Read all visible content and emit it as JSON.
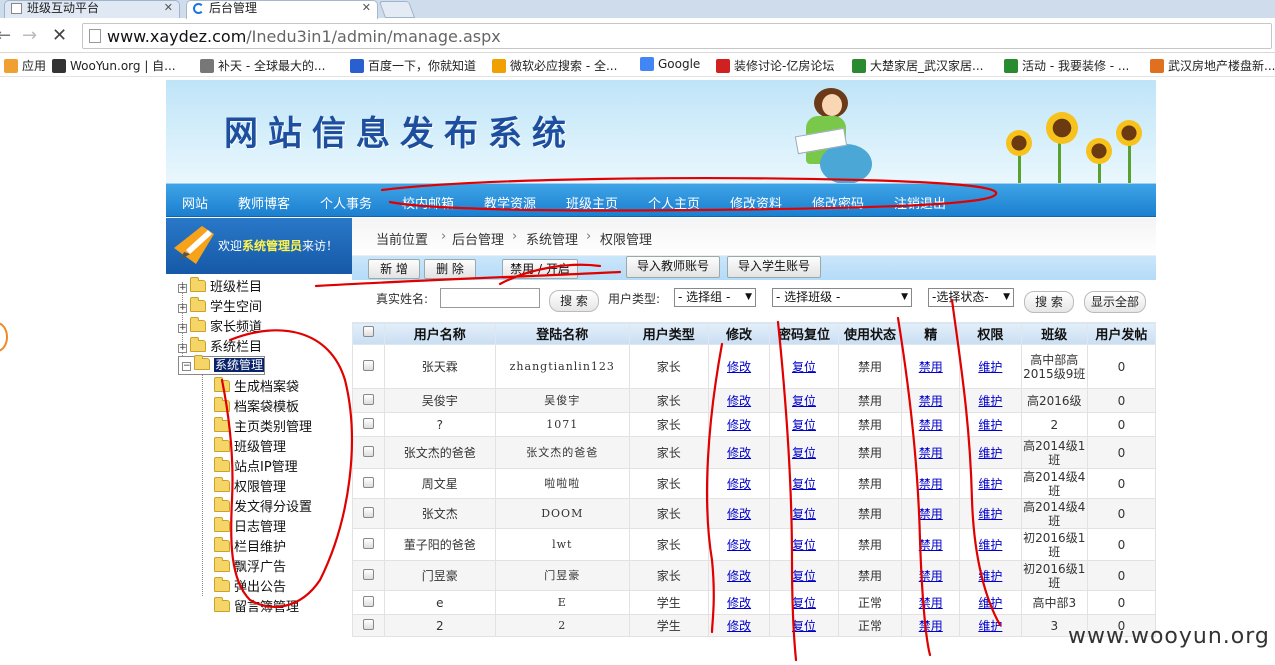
{
  "browser": {
    "tabs": [
      {
        "title": "班级互动平台",
        "active": false
      },
      {
        "title": "后台管理",
        "active": true
      }
    ],
    "url_host": "www.xaydez.com",
    "url_path": "/Inedu3in1/admin/manage.aspx",
    "bookmarks": [
      {
        "label": "应用",
        "icon": "apps-icon",
        "color": "#f0a030"
      },
      {
        "label": "WooYun.org | 自...",
        "icon": "wooyun-icon",
        "color": "#333333"
      },
      {
        "label": "补天 - 全球最大的...",
        "icon": "star-icon",
        "color": "#777777"
      },
      {
        "label": "百度一下，你就知道",
        "icon": "baidu-paw-icon",
        "color": "#2a5fd0"
      },
      {
        "label": "微软必应搜索 - 全...",
        "icon": "bing-icon",
        "color": "#f0a000"
      },
      {
        "label": "Google",
        "icon": "google-icon",
        "color": "#4285f4"
      },
      {
        "label": "装修讨论-亿房论坛",
        "icon": "fang-icon",
        "color": "#d02020"
      },
      {
        "label": "大楚家居_武汉家居...",
        "icon": "chrome-icon",
        "color": "#2a8a30"
      },
      {
        "label": "活动 - 我要装修 - ...",
        "icon": "chrome-icon",
        "color": "#2a8a30"
      },
      {
        "label": "武汉房地产楼盘新...",
        "icon": "house-icon",
        "color": "#e07020"
      }
    ]
  },
  "site": {
    "title": "网站信息发布系统",
    "menu": [
      "网站",
      "教师博客",
      "个人事务",
      "校内邮箱",
      "教学资源",
      "班级主页",
      "个人主页",
      "修改资料",
      "修改密码",
      "注销退出"
    ]
  },
  "sidebar": {
    "welcome_prefix": "欢迎",
    "welcome_role": "系统管理员",
    "welcome_suffix": "来访！",
    "top_nodes": [
      "班级栏目",
      "学生空间",
      "家长频道",
      "系统栏目",
      "系统管理"
    ],
    "sub_nodes": [
      "生成档案袋",
      "档案袋模板",
      "主页类别管理",
      "班级管理",
      "站点IP管理",
      "权限管理",
      "发文得分设置",
      "日志管理",
      "栏目维护",
      "飘浮广告",
      "弹出公告",
      "留言簿管理"
    ]
  },
  "breadcrumb": [
    "当前位置",
    "后台管理",
    "系统管理",
    "权限管理"
  ],
  "actions": {
    "add": "新 增",
    "delete": "删 除",
    "toggle": "禁用 / 开启",
    "import_teacher": "导入教师账号",
    "import_student": "导入学生账号"
  },
  "search": {
    "name_label": "真实姓名:",
    "name_value": "",
    "search_btn": "搜 索",
    "type_label": "用户类型:",
    "group_select": "- 选择组 -",
    "class_select": "- 选择班级 -",
    "state_select": "-选择状态-",
    "search_btn2": "搜 索",
    "show_all": "显示全部"
  },
  "table": {
    "headers": [
      "",
      "用户名称",
      "登陆名称",
      "用户类型",
      "修改",
      "密码复位",
      "使用状态",
      "精",
      "权限",
      "班级",
      "用户发帖"
    ],
    "rows": [
      {
        "name": "张天霖",
        "login": "zhangtianlin123",
        "type": "家长",
        "edit": "修改",
        "reset": "复位",
        "state": "禁用",
        "jing": "禁用",
        "perm": "维护",
        "cls": "高中部高2015级9班",
        "posts": "0"
      },
      {
        "name": "吴俊宇",
        "login": "吴俊宇",
        "type": "家长",
        "edit": "修改",
        "reset": "复位",
        "state": "禁用",
        "jing": "禁用",
        "perm": "维护",
        "cls": "高2016级",
        "posts": "0"
      },
      {
        "name": "?",
        "login": "1071",
        "type": "家长",
        "edit": "修改",
        "reset": "复位",
        "state": "禁用",
        "jing": "禁用",
        "perm": "维护",
        "cls": "2",
        "posts": "0"
      },
      {
        "name": "张文杰的爸爸",
        "login": "张文杰的爸爸",
        "type": "家长",
        "edit": "修改",
        "reset": "复位",
        "state": "禁用",
        "jing": "禁用",
        "perm": "维护",
        "cls": "高2014级1班",
        "posts": "0"
      },
      {
        "name": "周文星",
        "login": "啦啦啦",
        "type": "家长",
        "edit": "修改",
        "reset": "复位",
        "state": "禁用",
        "jing": "禁用",
        "perm": "维护",
        "cls": "高2014级4班",
        "posts": "0"
      },
      {
        "name": "张文杰",
        "login": "DOOM",
        "type": "家长",
        "edit": "修改",
        "reset": "复位",
        "state": "禁用",
        "jing": "禁用",
        "perm": "维护",
        "cls": "高2014级4班",
        "posts": "0"
      },
      {
        "name": "董子阳的爸爸",
        "login": "lwt",
        "type": "家长",
        "edit": "修改",
        "reset": "复位",
        "state": "禁用",
        "jing": "禁用",
        "perm": "维护",
        "cls": "初2016级1班",
        "posts": "0"
      },
      {
        "name": "门昱豪",
        "login": "门昱豪",
        "type": "家长",
        "edit": "修改",
        "reset": "复位",
        "state": "禁用",
        "jing": "禁用",
        "perm": "维护",
        "cls": "初2016级1班",
        "posts": "0"
      },
      {
        "name": "e",
        "login": "E",
        "type": "学生",
        "edit": "修改",
        "reset": "复位",
        "state": "正常",
        "jing": "禁用",
        "perm": "维护",
        "cls": "高中部3",
        "posts": "0"
      },
      {
        "name": "2",
        "login": "2",
        "type": "学生",
        "edit": "修改",
        "reset": "复位",
        "state": "正常",
        "jing": "禁用",
        "perm": "维护",
        "cls": "3",
        "posts": "0"
      }
    ]
  },
  "watermark": "www.wooyun.org",
  "colors": {
    "menu_bar": "#1b7fd0",
    "link": "#0000cc",
    "annotation": "#e00000",
    "selected_node": "#0a246a"
  }
}
